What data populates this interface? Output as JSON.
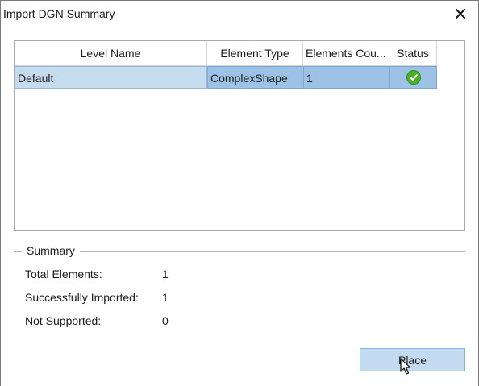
{
  "window": {
    "title": "Import DGN Summary",
    "close_glyph": "✕"
  },
  "grid": {
    "columns": [
      "Level Name",
      "Element Type",
      "Elements  Cou...",
      "Status"
    ],
    "rows": [
      {
        "level_name": "Default",
        "element_type": "ComplexShape",
        "elements_count": "1",
        "status": "success-check-icon"
      }
    ]
  },
  "summary": {
    "heading": "Summary",
    "items": [
      {
        "label": "Total Elements:",
        "value": "1"
      },
      {
        "label": "Successfully Imported:",
        "value": "1"
      },
      {
        "label": "Not Supported:",
        "value": "0"
      }
    ]
  },
  "actions": {
    "place_label": "Place"
  },
  "colors": {
    "row_selected_first": "#c5dcef",
    "row_selected": "#9cc2e6",
    "status_success": "#4caf2b",
    "button_bg": "#c3dbf1"
  }
}
